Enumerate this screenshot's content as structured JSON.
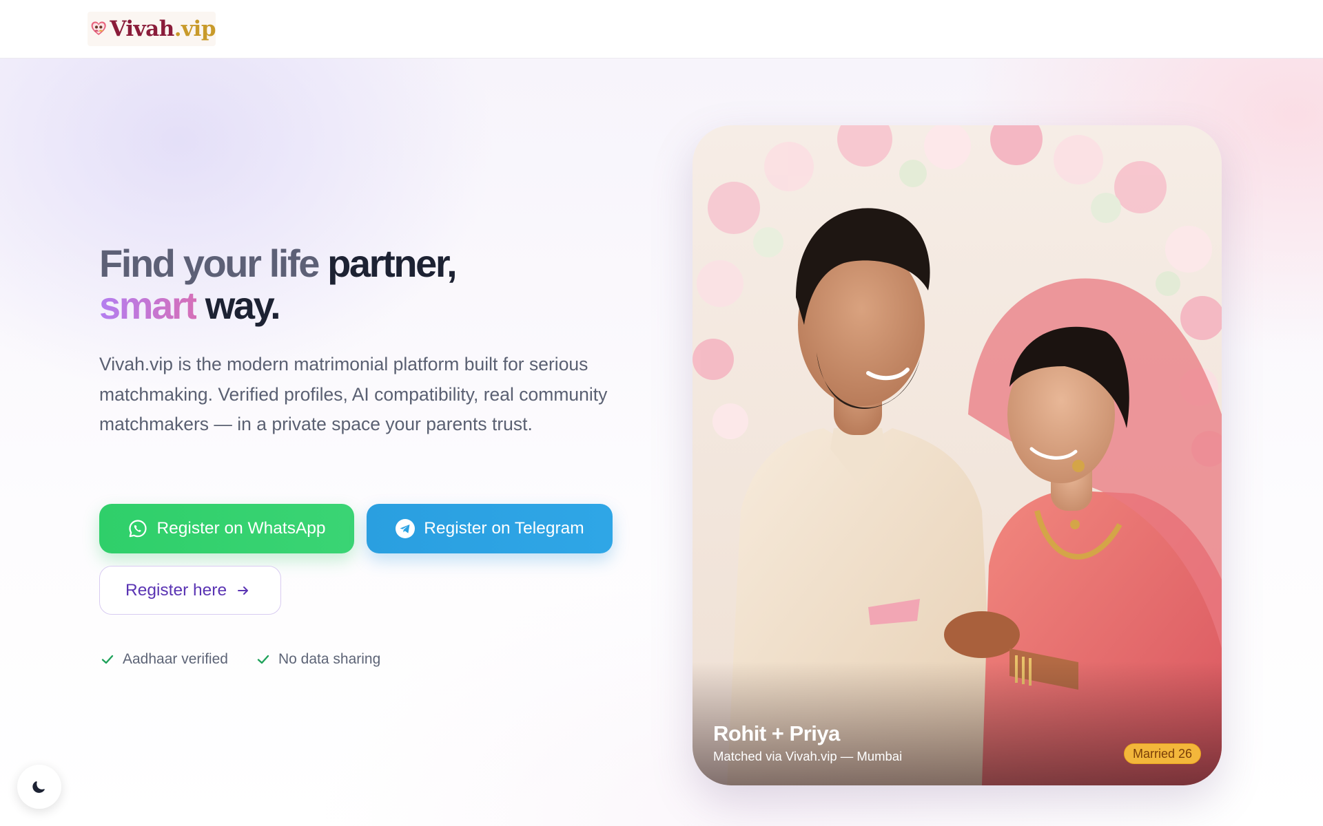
{
  "brand": {
    "name": "Vivah",
    "suffix": ".vip"
  },
  "hero": {
    "headline_line1_light": "Find your life",
    "headline_line1_dark": " partner,",
    "headline_line2_accent": "smart",
    "headline_line2_dark": " way.",
    "description": "Vivah.vip is the modern matrimonial platform built for serious matchmaking. Verified profiles, AI compatibility, real community matchmakers — in a private space your parents trust."
  },
  "buttons": {
    "whatsapp_label": "Register on WhatsApp",
    "telegram_label": "Register on Telegram",
    "register_label": "Register here"
  },
  "trust": [
    {
      "label": "Aadhaar verified",
      "icon": "check-icon"
    },
    {
      "label": "No data sharing",
      "icon": "check-icon"
    }
  ],
  "photo": {
    "couple": "Rohit + Priya",
    "matched_line": "Matched via Vivah.vip — Mumbai",
    "badge": "Married 26"
  },
  "colors": {
    "whatsapp": "#34d06e",
    "telegram": "#2aa2e3",
    "accent_purple": "#5a34b3",
    "badge": "#f3b73b",
    "check": "#1fa25a"
  },
  "icons": {
    "theme_toggle": "moon-icon",
    "whatsapp": "whatsapp-icon",
    "telegram": "telegram-icon",
    "arrow": "arrow-right-icon"
  }
}
